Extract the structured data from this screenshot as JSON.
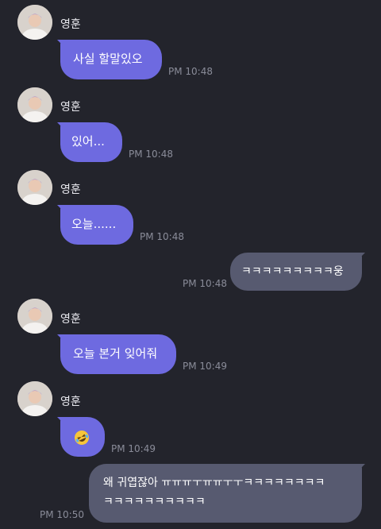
{
  "messages": [
    {
      "sender": "영훈",
      "text": "사실 할말있오",
      "time": "PM 10:48"
    },
    {
      "sender": "영훈",
      "text": "있어...",
      "time": "PM 10:48"
    },
    {
      "sender": "영훈",
      "text": "오늘......",
      "time": "PM 10:48"
    },
    {
      "sender": "me",
      "text": "ㅋㅋㅋㅋㅋㅋㅋㅋㅋ웅",
      "time": "PM 10:48"
    },
    {
      "sender": "영훈",
      "text": "오늘 본거 잊어줘",
      "time": "PM 10:49"
    },
    {
      "sender": "영훈",
      "emoji": "rolling-on-floor-laughing",
      "time": "PM 10:49"
    },
    {
      "sender": "me",
      "text_line1": "왜 귀엽잖아 ㅠㅠㅠㅜㅠㅠㅜㅜㅋㅋㅋㅋㅋㅋㅋㅋ",
      "text_line2": "ㅋㅋㅋㅋㅋㅋㅋㅋㅋㅋ",
      "time": "PM 10:50"
    }
  ],
  "colors": {
    "background": "#23242c",
    "incoming_bubble": "#6e6ae0",
    "outgoing_bubble": "#575a70",
    "timestamp": "#8a8c99"
  }
}
